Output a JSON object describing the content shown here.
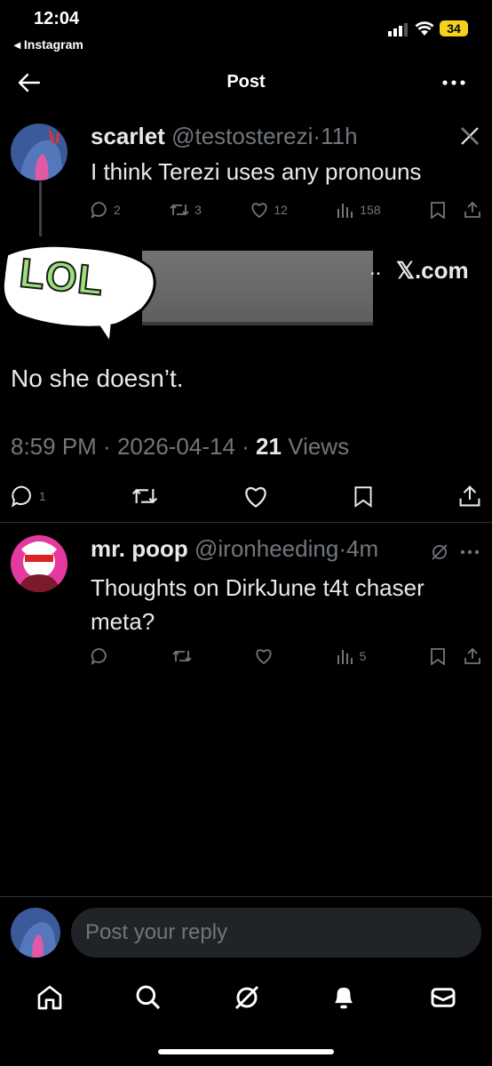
{
  "status_bar": {
    "time": "12:04",
    "back_app": "Instagram",
    "battery": "34"
  },
  "nav": {
    "title": "Post"
  },
  "quoted_tweet": {
    "display_name": "scarlet",
    "handle": "@testosterezi",
    "time_ago": "11h",
    "text": "I think Terezi uses any pronouns",
    "stats": {
      "replies": "2",
      "reposts": "3",
      "likes": "12",
      "views": "158"
    }
  },
  "link_preview": {
    "ellipsis": "..",
    "domain": "𝕏.com",
    "sticker_text": "LOL"
  },
  "main_post": {
    "text": "No she doesn’t.",
    "time": "8:59 PM",
    "date": "2026-04-14",
    "views_count": "21",
    "views_label": "Views",
    "replies": "1"
  },
  "reply": {
    "display_name": "mr. poop",
    "handle": "@ironheeding",
    "time_ago": "4m",
    "text": "Thoughts on DirkJune t4t chaser meta?",
    "views": "5"
  },
  "composer": {
    "placeholder": "Post your reply"
  },
  "colors": {
    "bg": "#000000",
    "text": "#e7e9ea",
    "muted": "#71767b",
    "divider": "#2f3336",
    "input_bg": "#202327",
    "battery": "#f5d21f"
  }
}
